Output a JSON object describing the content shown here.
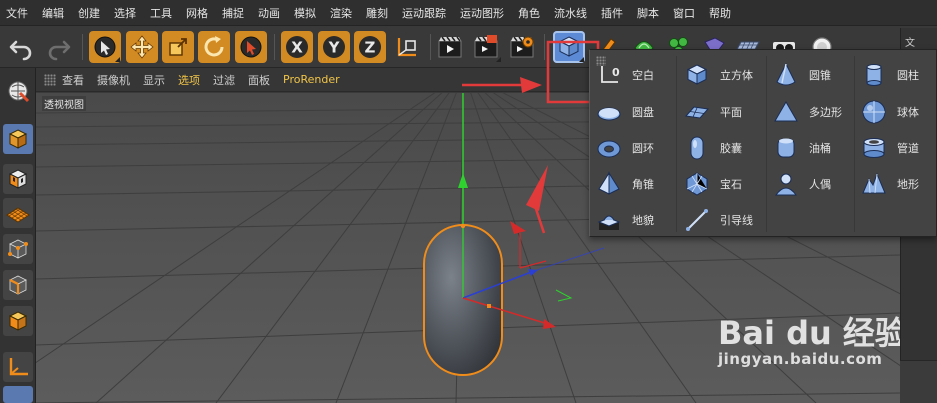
{
  "menubar": {
    "items": [
      "文件",
      "编辑",
      "创建",
      "选择",
      "工具",
      "网格",
      "捕捉",
      "动画",
      "模拟",
      "渲染",
      "雕刻",
      "运动跟踪",
      "运动图形",
      "角色",
      "流水线",
      "插件",
      "脚本",
      "窗口",
      "帮助"
    ]
  },
  "toolbar": {
    "buttons": [
      "undo-icon",
      "redo-icon",
      "live-select-icon",
      "move-icon",
      "scale-icon",
      "rotate-icon",
      "select-icon",
      "x-axis-icon",
      "y-axis-icon",
      "z-axis-icon",
      "coordinate-system-icon",
      "render-view-icon",
      "render-picture-viewer-icon",
      "render-settings-icon",
      "cube-icon",
      "pen-icon",
      "subdivision-icon",
      "array-icon",
      "deformer-icon",
      "floor-icon",
      "camera-icon",
      "light-icon"
    ],
    "axis_labels": {
      "x": "X",
      "y": "Y",
      "z": "Z"
    }
  },
  "right_panel": {
    "tab_label": "文"
  },
  "left_palette": {
    "buttons": [
      "model-mode-icon",
      "object-mode-icon",
      "texture-mode-icon",
      "workplane-icon",
      "points-mode-icon",
      "edges-mode-icon",
      "polygons-mode-icon",
      "axis-mode-icon"
    ]
  },
  "viewport_menu": {
    "items": [
      "查看",
      "摄像机",
      "显示",
      "选项",
      "过滤",
      "面板",
      "ProRender"
    ],
    "active": "选项"
  },
  "viewport": {
    "label": "透视视图",
    "accent_colors": {
      "y_axis": "#2ed12e",
      "x_axis": "#d42a2a",
      "z_axis": "#2a3fd4",
      "object_outline": "#f08c1a",
      "annotation": "#e23a3a"
    }
  },
  "object_popup": {
    "items": [
      {
        "label": "空白",
        "icon": "null-icon"
      },
      {
        "label": "立方体",
        "icon": "cube-icon"
      },
      {
        "label": "圆锥",
        "icon": "cone-icon"
      },
      {
        "label": "圆柱",
        "icon": "cylinder-icon"
      },
      {
        "label": "圆盘",
        "icon": "disc-icon"
      },
      {
        "label": "平面",
        "icon": "plane-icon"
      },
      {
        "label": "多边形",
        "icon": "polygon-icon"
      },
      {
        "label": "球体",
        "icon": "sphere-icon"
      },
      {
        "label": "圆环",
        "icon": "torus-icon"
      },
      {
        "label": "胶囊",
        "icon": "capsule-icon"
      },
      {
        "label": "油桶",
        "icon": "oil-tank-icon"
      },
      {
        "label": "管道",
        "icon": "tube-icon"
      },
      {
        "label": "角锥",
        "icon": "pyramid-icon"
      },
      {
        "label": "宝石",
        "icon": "platonic-icon"
      },
      {
        "label": "人偶",
        "icon": "figure-icon"
      },
      {
        "label": "地形",
        "icon": "landscape-icon"
      },
      {
        "label": "地貌",
        "icon": "relief-icon"
      },
      {
        "label": "引导线",
        "icon": "guide-icon"
      }
    ]
  },
  "watermark": {
    "brand": "Bai du 经验",
    "url": "jingyan.baidu.com"
  }
}
